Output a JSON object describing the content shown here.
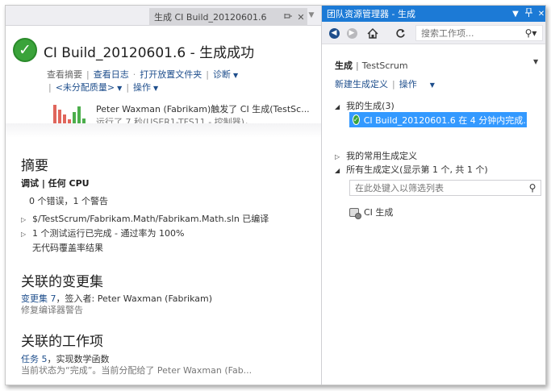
{
  "doc_tab": {
    "title": "生成 CI Build_20120601.6",
    "pin_icon": "pin-icon",
    "close_icon": "close-icon"
  },
  "build": {
    "status_icon": "success-check-icon",
    "title": "CI Build_20120601.6 - 生成成功",
    "links_row1": {
      "summary": "查看摘要",
      "log": "查看日志",
      "drop": "打开放置文件夹",
      "diagnose": "诊断"
    },
    "links_row2": {
      "quality": "<未分配质量>",
      "actions": "操作"
    },
    "histogram": [
      {
        "value": 0.85,
        "color": "#e0665c"
      },
      {
        "value": 0.65,
        "color": "#e0665c"
      },
      {
        "value": 0.45,
        "color": "#e0665c"
      },
      {
        "value": 0.25,
        "color": "#e0665c"
      },
      {
        "value": 0.55,
        "color": "#4cae4c"
      },
      {
        "value": 0.8,
        "color": "#4cae4c"
      },
      {
        "value": 0.3,
        "color": "#4cae4c"
      }
    ],
    "trigger_line": "Peter Waxman (Fabrikam)触发了 CI 生成(TestSc...",
    "runtime_line": "运行了 7 秒(USER1-TFS11 - 控制器)，..."
  },
  "summary": {
    "title": "摘要",
    "config": "调试 | 任何 CPU",
    "errors": "0 个错误，1 个警告",
    "compiled": "$/TestScrum/Fabrikam.Math/Fabrikam.Math.sln 已编译",
    "tests": "1 个测试运行已完成 - 通过率为 100%",
    "coverage": "无代码覆盖率结果"
  },
  "changesets": {
    "title": "关联的变更集",
    "link": "变更集 7",
    "checked_in": "，签入者: Peter Waxman (Fabrikam)",
    "comment": "修复编译器警告"
  },
  "workitems": {
    "title": "关联的工作项",
    "link": "任务 5",
    "name": "，实现数学函数",
    "state": "当前状态为“完成”。当前分配给了 Peter Waxman (Fab..."
  },
  "team_explorer": {
    "title": "团队资源管理器 - 生成",
    "search_placeholder": "搜索工作项...",
    "section": "生成",
    "project": "TestScrum",
    "new_build_def": "新建生成定义",
    "actions": "操作",
    "my_builds": "我的生成(3)",
    "selected_build": "CI Build_20120601.6 在 4 分钟内完成...",
    "favorite_defs": "我的常用生成定义",
    "all_defs": "所有生成定义(显示第 1 个, 共 1 个)",
    "filter_placeholder": "在此处键入以筛选列表",
    "definition": "CI 生成"
  },
  "colors": {
    "accent": "#1c7ad6",
    "selection": "#3399ff",
    "link": "#1e4e8c",
    "success": "#3aa33a"
  }
}
